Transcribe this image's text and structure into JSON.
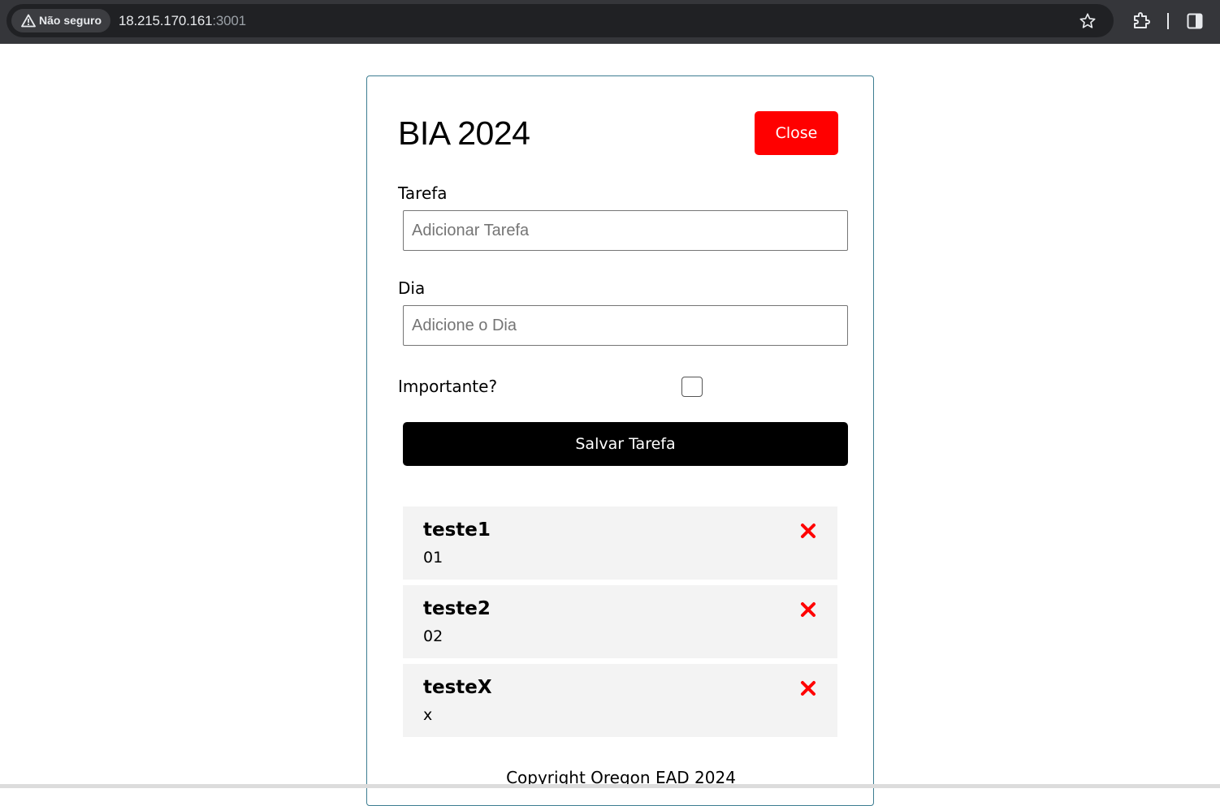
{
  "browser": {
    "security_label": "Não seguro",
    "url_host": "18.215.170.161",
    "url_port": ":3001",
    "icons": [
      "warning-icon",
      "star-icon",
      "extensions-icon",
      "side-panel-icon"
    ]
  },
  "header": {
    "title": "BIA 2024",
    "close_label": "Close"
  },
  "form": {
    "tarefa_label": "Tarefa",
    "tarefa_placeholder": "Adicionar Tarefa",
    "dia_label": "Dia",
    "dia_placeholder": "Adicione o Dia",
    "importante_label": "Importante?",
    "importante_checked": false,
    "save_label": "Salvar Tarefa"
  },
  "tasks": [
    {
      "name": "teste1",
      "day": "01"
    },
    {
      "name": "teste2",
      "day": "02"
    },
    {
      "name": "testeX",
      "day": "x"
    }
  ],
  "footer": {
    "text": "Copyright Oregon EAD 2024"
  },
  "colors": {
    "close_button": "#ff0000",
    "save_button": "#000000",
    "delete_icon": "#ff0000",
    "card_border": "#3d7d91",
    "task_background": "#f3f3f3"
  }
}
